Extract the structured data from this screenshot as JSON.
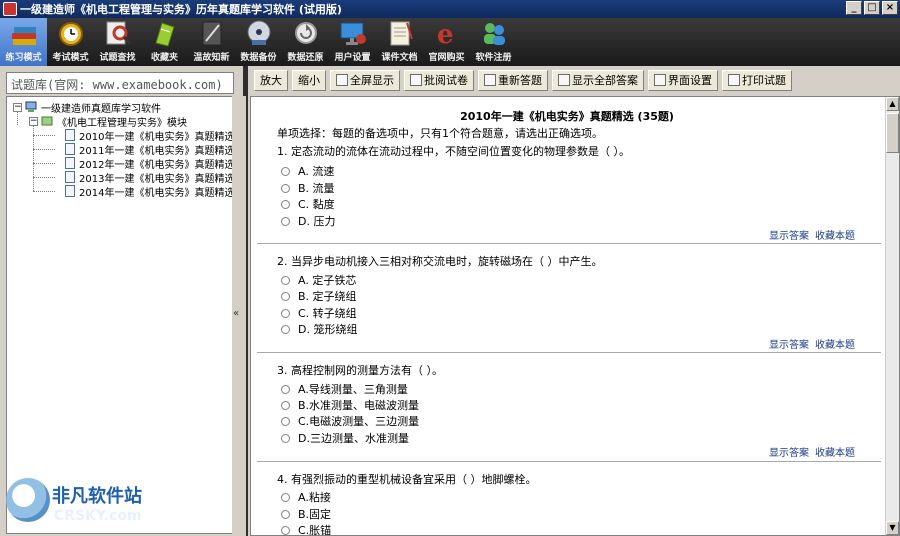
{
  "window": {
    "title": "一级建造师《机电工程管理与实务》历年真题库学习软件 (试用版)",
    "buttons": [
      "_",
      "□",
      "×"
    ]
  },
  "toolbar": {
    "items": [
      {
        "label": "练习模式",
        "icon": "books-icon"
      },
      {
        "label": "考试模式",
        "icon": "alarm-clock-icon"
      },
      {
        "label": "试题查找",
        "icon": "magnifier-icon"
      },
      {
        "label": "收藏夹",
        "icon": "folder-icon"
      },
      {
        "label": "温故知新",
        "icon": "notebook-icon"
      },
      {
        "label": "数据备份",
        "icon": "disk-icon"
      },
      {
        "label": "数据还原",
        "icon": "restore-icon"
      },
      {
        "label": "用户设置",
        "icon": "monitor-icon"
      },
      {
        "label": "课件文档",
        "icon": "document-icon"
      },
      {
        "label": "官网购买",
        "icon": "ie-icon"
      },
      {
        "label": "软件注册",
        "icon": "user-icon"
      }
    ]
  },
  "left": {
    "header": "试题库(官网: www.examebook.com)",
    "root": "一级建造师真题库学习软件",
    "module": "《机电工程管理与实务》模块",
    "items": [
      "2010年一建《机电实务》真题精选",
      "2011年一建《机电实务》真题精选",
      "2012年一建《机电实务》真题精选",
      "2013年一建《机电实务》真题精选",
      "2014年一建《机电实务》真题精选"
    ]
  },
  "right": {
    "buttons": [
      "放大",
      "缩小",
      "全屏显示",
      "批阅试卷",
      "重新答题",
      "显示全部答案",
      "界面设置",
      "打印试题"
    ],
    "title": "2010年一建《机电实务》真题精选 (35题)",
    "intro": "单项选择：每题的备选项中，只有1个符合题意，请选出正确选项。",
    "links": {
      "show": "显示答案",
      "fav": "收藏本题"
    },
    "questions": [
      {
        "text": "1. 定态流动的流体在流动过程中，不随空间位置变化的物理参数是（   ）。",
        "options": [
          "A. 流速",
          "B. 流量",
          "C. 黏度",
          "D. 压力"
        ]
      },
      {
        "text": "2. 当异步电动机接入三相对称交流电时，旋转磁场在（   ）中产生。",
        "options": [
          "A. 定子铁芯",
          "B. 定子绕组",
          "C. 转子绕组",
          "D. 笼形绕组"
        ]
      },
      {
        "text": "3. 高程控制网的测量方法有（  ）。",
        "options": [
          "A.导线测量、三角测量",
          "B.水准测量、电磁波测量",
          "C.电磁波测量、三边测量",
          "D.三边测量、水准测量"
        ]
      },
      {
        "text": "4. 有强烈振动的重型机械设备宜采用（  ）地脚螺栓。",
        "options": [
          "A.粘接",
          "B.固定",
          "C.胀锚"
        ]
      }
    ]
  },
  "watermark": {
    "cn": "非凡软件站",
    "en": "CRSKY.com"
  }
}
